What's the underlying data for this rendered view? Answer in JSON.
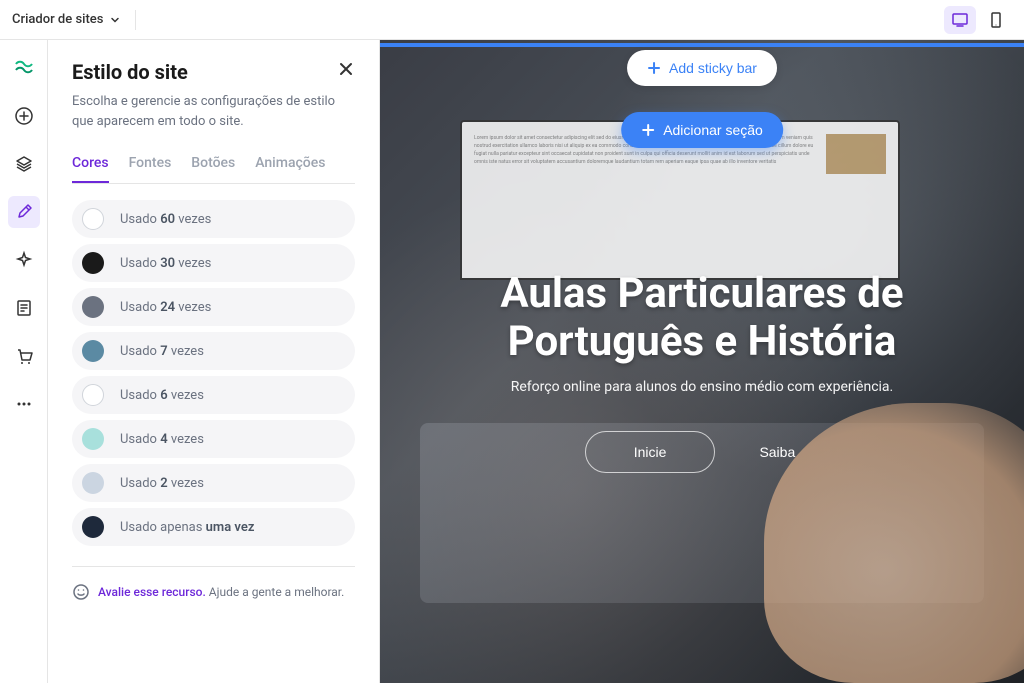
{
  "topbar": {
    "title": "Criador de sites"
  },
  "panel": {
    "title": "Estilo do site",
    "description": "Escolha e gerencie as configurações de estilo que aparecem em todo o site.",
    "tabs": [
      "Cores",
      "Fontes",
      "Botões",
      "Animações"
    ],
    "active_tab": 0,
    "usage_prefix": "Usado",
    "usage_suffix": "vezes",
    "usage_once_prefix": "Usado apenas",
    "usage_once_bold": "uma vez",
    "colors": [
      {
        "hex": "#ffffff",
        "count": "60",
        "bordered": true
      },
      {
        "hex": "#1a1a1a",
        "count": "30",
        "bordered": false
      },
      {
        "hex": "#6b7280",
        "count": "24",
        "bordered": false
      },
      {
        "hex": "#5b8aa3",
        "count": "7",
        "bordered": false
      },
      {
        "hex": "#ffffff",
        "count": "6",
        "bordered": true
      },
      {
        "hex": "#a8e0dc",
        "count": "4",
        "bordered": false
      },
      {
        "hex": "#cbd5e1",
        "count": "2",
        "bordered": false
      },
      {
        "hex": "#1e293b",
        "count": null,
        "once": true,
        "bordered": false
      }
    ],
    "feedback_link": "Avalie esse recurso.",
    "feedback_text": "Ajude a gente a melhorar."
  },
  "canvas": {
    "sticky_label": "Add sticky bar",
    "section_label": "Adicionar seção",
    "hero_title_line1": "Aulas Particulares de",
    "hero_title_line2": "Português e História",
    "hero_sub": "Reforço online para alunos do ensino médio com experiência.",
    "btn_primary": "Inicie",
    "btn_secondary": "Saiba"
  }
}
